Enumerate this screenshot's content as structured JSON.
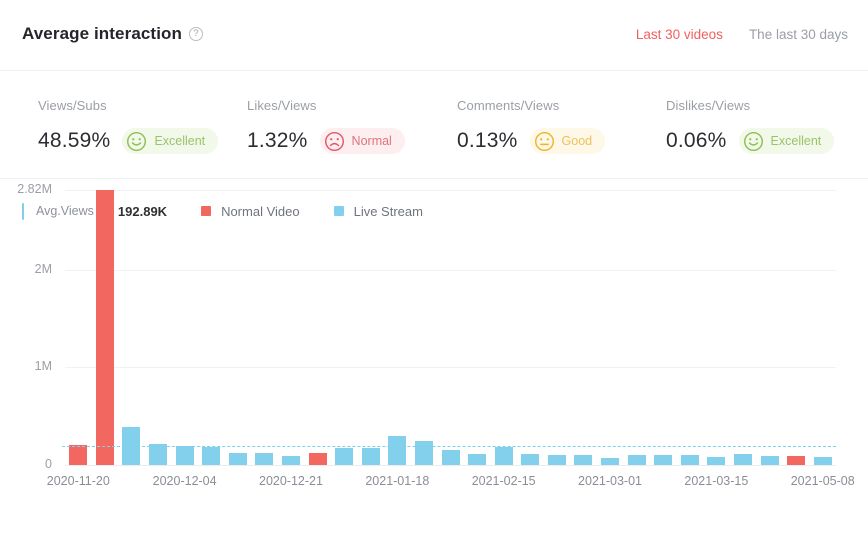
{
  "header": {
    "title": "Average interaction",
    "help_icon": "question-circle-icon",
    "tabs": [
      {
        "label": "Last 30 videos",
        "active": true
      },
      {
        "label": "The last 30 days",
        "active": false
      }
    ]
  },
  "metrics": [
    {
      "label": "Views/Subs",
      "value": "48.59%",
      "rating": "Excellent",
      "face": "smile-face-icon",
      "tone": "excellent"
    },
    {
      "label": "Likes/Views",
      "value": "1.32%",
      "rating": "Normal",
      "face": "frown-face-icon",
      "tone": "normal"
    },
    {
      "label": "Comments/Views",
      "value": "0.13%",
      "rating": "Good",
      "face": "neutral-face-icon",
      "tone": "good"
    },
    {
      "label": "Dislikes/Views",
      "value": "0.06%",
      "rating": "Excellent",
      "face": "smile-face-icon",
      "tone": "excellent"
    }
  ],
  "legend": {
    "avg_label": "Avg.Views",
    "avg_help_icon": "question-circle-icon",
    "avg_value": "192.89K",
    "series": [
      {
        "label": "Normal Video",
        "color": "#f2675f"
      },
      {
        "label": "Live Stream",
        "color": "#83d0ec"
      }
    ]
  },
  "colors": {
    "accent_red": "#f0605f",
    "normal_video": "#f2675f",
    "live_stream": "#83d0ec",
    "avg_line": "#7fcfe8",
    "excellent": "#9bc468",
    "normal_rating": "#e0737f",
    "good": "#eec159"
  },
  "chart_data": {
    "type": "bar",
    "title": "Average interaction",
    "xlabel": "",
    "ylabel": "",
    "ylim": [
      0,
      2820000
    ],
    "grid": true,
    "legend_position": "top-left",
    "y_ticks": [
      {
        "value": 0,
        "label": "0"
      },
      {
        "value": 1000000,
        "label": "1M"
      },
      {
        "value": 2000000,
        "label": "2M"
      },
      {
        "value": 2820000,
        "label": "2.82M"
      }
    ],
    "x_tick_labels": [
      "2020-11-20",
      "2020-12-04",
      "2020-12-21",
      "2021-01-18",
      "2021-02-15",
      "2021-03-01",
      "2021-03-15",
      "2021-05-08"
    ],
    "x_tick_indices": [
      0,
      4,
      8,
      12,
      16,
      20,
      24,
      28
    ],
    "average_line": {
      "value": 192890,
      "label": "192.89K",
      "style": "dashed"
    },
    "series_names": [
      "Normal Video",
      "Live Stream"
    ],
    "bars": [
      {
        "index": 0,
        "value": 210000,
        "series": "Normal Video"
      },
      {
        "index": 1,
        "value": 2820000,
        "series": "Normal Video"
      },
      {
        "index": 2,
        "value": 390000,
        "series": "Live Stream"
      },
      {
        "index": 3,
        "value": 215000,
        "series": "Live Stream"
      },
      {
        "index": 4,
        "value": 195000,
        "series": "Live Stream"
      },
      {
        "index": 5,
        "value": 185000,
        "series": "Live Stream"
      },
      {
        "index": 6,
        "value": 125000,
        "series": "Live Stream"
      },
      {
        "index": 7,
        "value": 125000,
        "series": "Live Stream"
      },
      {
        "index": 8,
        "value": 90000,
        "series": "Live Stream"
      },
      {
        "index": 9,
        "value": 120000,
        "series": "Normal Video"
      },
      {
        "index": 10,
        "value": 175000,
        "series": "Live Stream"
      },
      {
        "index": 11,
        "value": 175000,
        "series": "Live Stream"
      },
      {
        "index": 12,
        "value": 300000,
        "series": "Live Stream"
      },
      {
        "index": 13,
        "value": 250000,
        "series": "Live Stream"
      },
      {
        "index": 14,
        "value": 150000,
        "series": "Live Stream"
      },
      {
        "index": 15,
        "value": 110000,
        "series": "Live Stream"
      },
      {
        "index": 16,
        "value": 185000,
        "series": "Live Stream"
      },
      {
        "index": 17,
        "value": 110000,
        "series": "Live Stream"
      },
      {
        "index": 18,
        "value": 105000,
        "series": "Live Stream"
      },
      {
        "index": 19,
        "value": 105000,
        "series": "Live Stream"
      },
      {
        "index": 20,
        "value": 75000,
        "series": "Live Stream"
      },
      {
        "index": 21,
        "value": 100000,
        "series": "Live Stream"
      },
      {
        "index": 22,
        "value": 105000,
        "series": "Live Stream"
      },
      {
        "index": 23,
        "value": 100000,
        "series": "Live Stream"
      },
      {
        "index": 24,
        "value": 80000,
        "series": "Live Stream"
      },
      {
        "index": 25,
        "value": 110000,
        "series": "Live Stream"
      },
      {
        "index": 26,
        "value": 95000,
        "series": "Live Stream"
      },
      {
        "index": 27,
        "value": 90000,
        "series": "Normal Video"
      },
      {
        "index": 28,
        "value": 85000,
        "series": "Live Stream"
      }
    ]
  }
}
